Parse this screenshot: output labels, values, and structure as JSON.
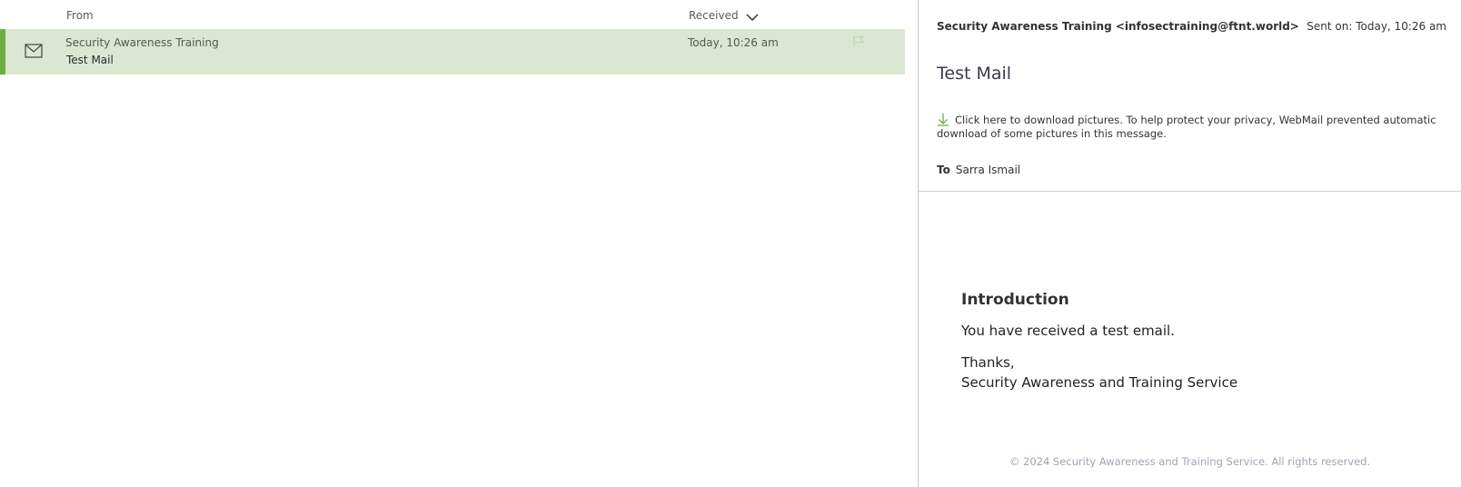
{
  "message_list": {
    "columns": {
      "from": "From",
      "received": "Received"
    },
    "selected_row": {
      "sender": "Security Awareness Training",
      "subject": "Test Mail",
      "date": "Today, 10:26 am"
    }
  },
  "reading_pane": {
    "from": "Security Awareness Training <infosectraining@ftnt.world>",
    "sent": "Sent on: Today, 10:26 am",
    "subject": "Test Mail",
    "picture_notice": "Click here to download pictures. To help protect your privacy, WebMail prevented automatic download of some pictures in this message.",
    "to_label": "To",
    "to_value": "Sarra Ismail",
    "body": {
      "heading": "Introduction",
      "text": "You have received a test email.",
      "thanks": "Thanks,",
      "signature": "Security Awareness and Training Service"
    },
    "footer": "© 2024 Security Awareness and Training Service. All rights reserved."
  },
  "colors": {
    "selected_row_bg": "#d9e7d3",
    "selected_bar": "#6fae45",
    "download_icon": "#6fae45"
  },
  "icons": {
    "sort": "chevron-down-icon",
    "message_type": "envelope-icon",
    "flag": "flag-icon",
    "download": "download-arrow-icon"
  }
}
